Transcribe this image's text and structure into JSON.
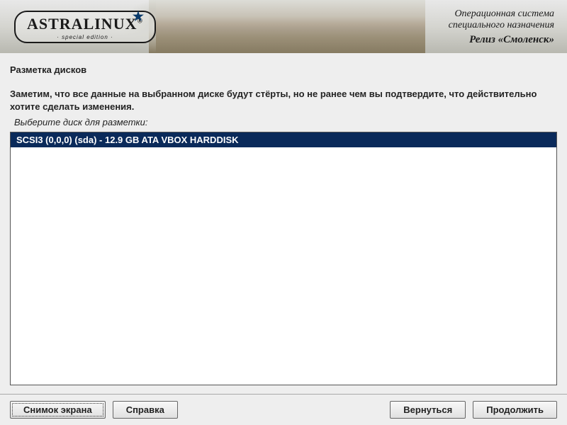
{
  "header": {
    "logo_text": "ASTRALINUX",
    "logo_subtitle": "· special edition ·",
    "os_line1": "Операционная система",
    "os_line2": "специального назначения",
    "release": "Релиз «Смоленск»"
  },
  "content": {
    "section_title": "Разметка дисков",
    "warning": "Заметим, что все данные на выбранном диске будут стёрты, но не ранее чем вы подтвердите, что действительно хотите сделать изменения.",
    "prompt": "Выберите диск для разметки:",
    "disks": [
      {
        "label": "SCSI3 (0,0,0) (sda) - 12.9 GB ATA VBOX HARDDISK",
        "selected": true
      }
    ]
  },
  "footer": {
    "screenshot": "Снимок экрана",
    "help": "Справка",
    "back": "Вернуться",
    "continue": "Продолжить"
  }
}
